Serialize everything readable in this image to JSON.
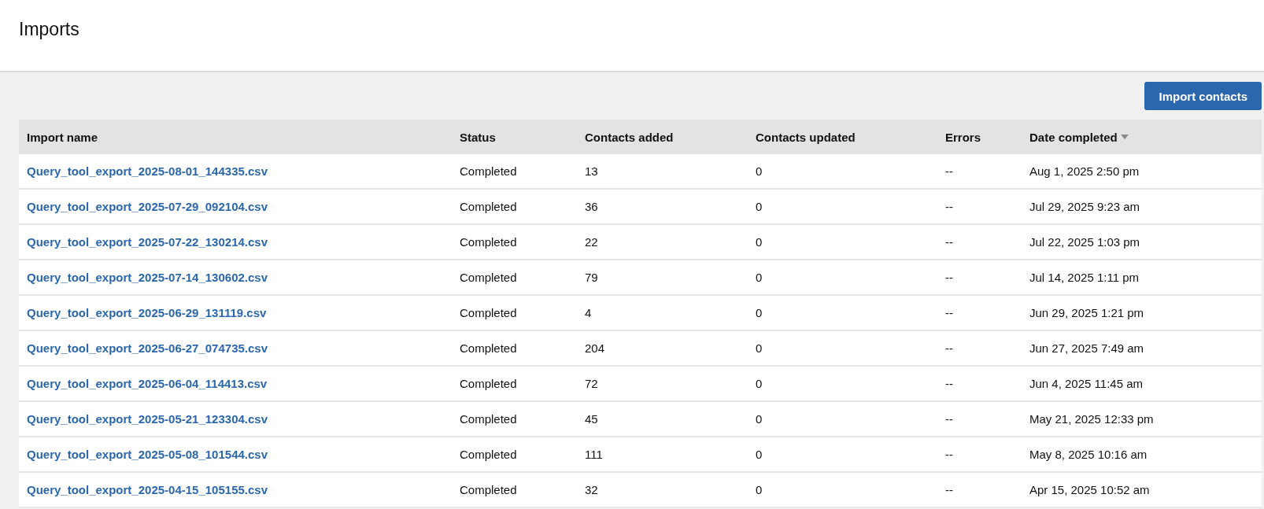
{
  "page": {
    "title": "Imports"
  },
  "toolbar": {
    "button": "Import contacts"
  },
  "table": {
    "columns": [
      {
        "label": "Import name",
        "sorted": false
      },
      {
        "label": "Status",
        "sorted": false
      },
      {
        "label": "Contacts added",
        "sorted": false
      },
      {
        "label": "Contacts updated",
        "sorted": false
      },
      {
        "label": "Errors",
        "sorted": false
      },
      {
        "label": "Date completed",
        "sorted": true
      }
    ],
    "rows": [
      {
        "name": "Query_tool_export_2025-08-01_144335.csv",
        "status": "Completed",
        "added": "13",
        "updated": "0",
        "errors": "--",
        "date": "Aug 1, 2025 2:50 pm"
      },
      {
        "name": "Query_tool_export_2025-07-29_092104.csv",
        "status": "Completed",
        "added": "36",
        "updated": "0",
        "errors": "--",
        "date": "Jul 29, 2025 9:23 am"
      },
      {
        "name": "Query_tool_export_2025-07-22_130214.csv",
        "status": "Completed",
        "added": "22",
        "updated": "0",
        "errors": "--",
        "date": "Jul 22, 2025 1:03 pm"
      },
      {
        "name": "Query_tool_export_2025-07-14_130602.csv",
        "status": "Completed",
        "added": "79",
        "updated": "0",
        "errors": "--",
        "date": "Jul 14, 2025 1:11 pm"
      },
      {
        "name": "Query_tool_export_2025-06-29_131119.csv",
        "status": "Completed",
        "added": "4",
        "updated": "0",
        "errors": "--",
        "date": "Jun 29, 2025 1:21 pm"
      },
      {
        "name": "Query_tool_export_2025-06-27_074735.csv",
        "status": "Completed",
        "added": "204",
        "updated": "0",
        "errors": "--",
        "date": "Jun 27, 2025 7:49 am"
      },
      {
        "name": "Query_tool_export_2025-06-04_114413.csv",
        "status": "Completed",
        "added": "72",
        "updated": "0",
        "errors": "--",
        "date": "Jun 4, 2025 11:45 am"
      },
      {
        "name": "Query_tool_export_2025-05-21_123304.csv",
        "status": "Completed",
        "added": "45",
        "updated": "0",
        "errors": "--",
        "date": "May 21, 2025 12:33 pm"
      },
      {
        "name": "Query_tool_export_2025-05-08_101544.csv",
        "status": "Completed",
        "added": "111",
        "updated": "0",
        "errors": "--",
        "date": "May 8, 2025 10:16 am"
      },
      {
        "name": "Query_tool_export_2025-04-15_105155.csv",
        "status": "Completed",
        "added": "32",
        "updated": "0",
        "errors": "--",
        "date": "Apr 15, 2025 10:52 am"
      }
    ]
  }
}
